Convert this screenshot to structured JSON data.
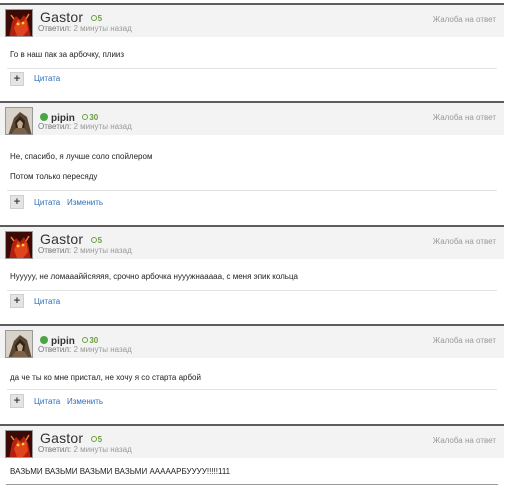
{
  "labels": {
    "report": "Жалоба на ответ",
    "answered": "Ответил:",
    "quote": "Цитата",
    "edit": "Изменить"
  },
  "posts": [
    {
      "author": "Gastor",
      "reputation": "5",
      "time": "2 минуты назад",
      "lines": [
        "Го в наш пак за арбочку, плииз"
      ]
    },
    {
      "author": "pipin",
      "reputation": "30",
      "time": "2 минуты назад",
      "lines": [
        "Не, спасибо, я лучше соло спойлером",
        "Потом только пересяду"
      ]
    },
    {
      "author": "Gastor",
      "reputation": "5",
      "time": "2 минуты назад",
      "lines": [
        "Нууууу, не ломаааййсяяяя, срочно арбочка нууужнааааа, с меня эпик кольца"
      ]
    },
    {
      "author": "pipin",
      "reputation": "30",
      "time": "2 минуты назад",
      "lines": [
        "да че ты ко мне пристал, не хочу я со старта арбой"
      ]
    },
    {
      "author": "Gastor",
      "reputation": "5",
      "time": "2 минуты назад",
      "lines": [
        "ВАЗЬМИ ВАЗЬМИ ВАЗЬМИ ВАЗЬМИ АААААРБУУУУ!!!!!111"
      ]
    }
  ],
  "colors": {
    "header_bg": "#f3f3f3",
    "link": "#2c6eb8",
    "reputation": "#6a9f3d",
    "online": "#4aa645"
  },
  "icons": {
    "gastor_avatar": "red-demon-avatar",
    "pipin_avatar": "hooded-figure-avatar",
    "plus": "plus-icon"
  }
}
